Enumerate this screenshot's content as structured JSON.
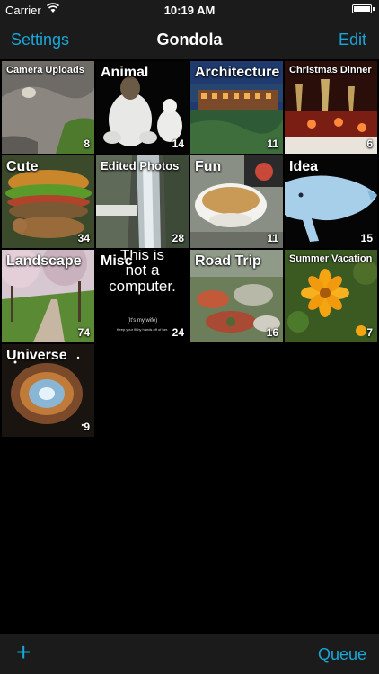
{
  "status_bar": {
    "carrier": "Carrier",
    "time": "10:19 AM",
    "battery_level": 1.0
  },
  "nav": {
    "left": "Settings",
    "title": "Gondola",
    "right": "Edit"
  },
  "albums": [
    {
      "name": "Camera Uploads",
      "count": "8"
    },
    {
      "name": "Animal",
      "count": "14"
    },
    {
      "name": "Architecture",
      "count": "11"
    },
    {
      "name": "Christmas Dinner",
      "count": "6"
    },
    {
      "name": "Cute",
      "count": "34"
    },
    {
      "name": "Edited Photos",
      "count": "28"
    },
    {
      "name": "Fun",
      "count": "11"
    },
    {
      "name": "Idea",
      "count": "15"
    },
    {
      "name": "Landscape",
      "count": "74"
    },
    {
      "name": "Misc",
      "count": "24"
    },
    {
      "name": "Road Trip",
      "count": "16"
    },
    {
      "name": "Summer Vacation",
      "count": "7"
    },
    {
      "name": "Universe",
      "count": "9"
    }
  ],
  "misc_thumb": {
    "line1": "This is",
    "line2": "not a",
    "line3": "computer.",
    "small1": "(It's my wife)",
    "small2": "Keep your filthy hands off of her."
  },
  "toolbar": {
    "add": "+",
    "queue": "Queue"
  },
  "colors": {
    "accent": "#1aa6d6",
    "bar": "#1b1b1b",
    "background": "#000000"
  }
}
